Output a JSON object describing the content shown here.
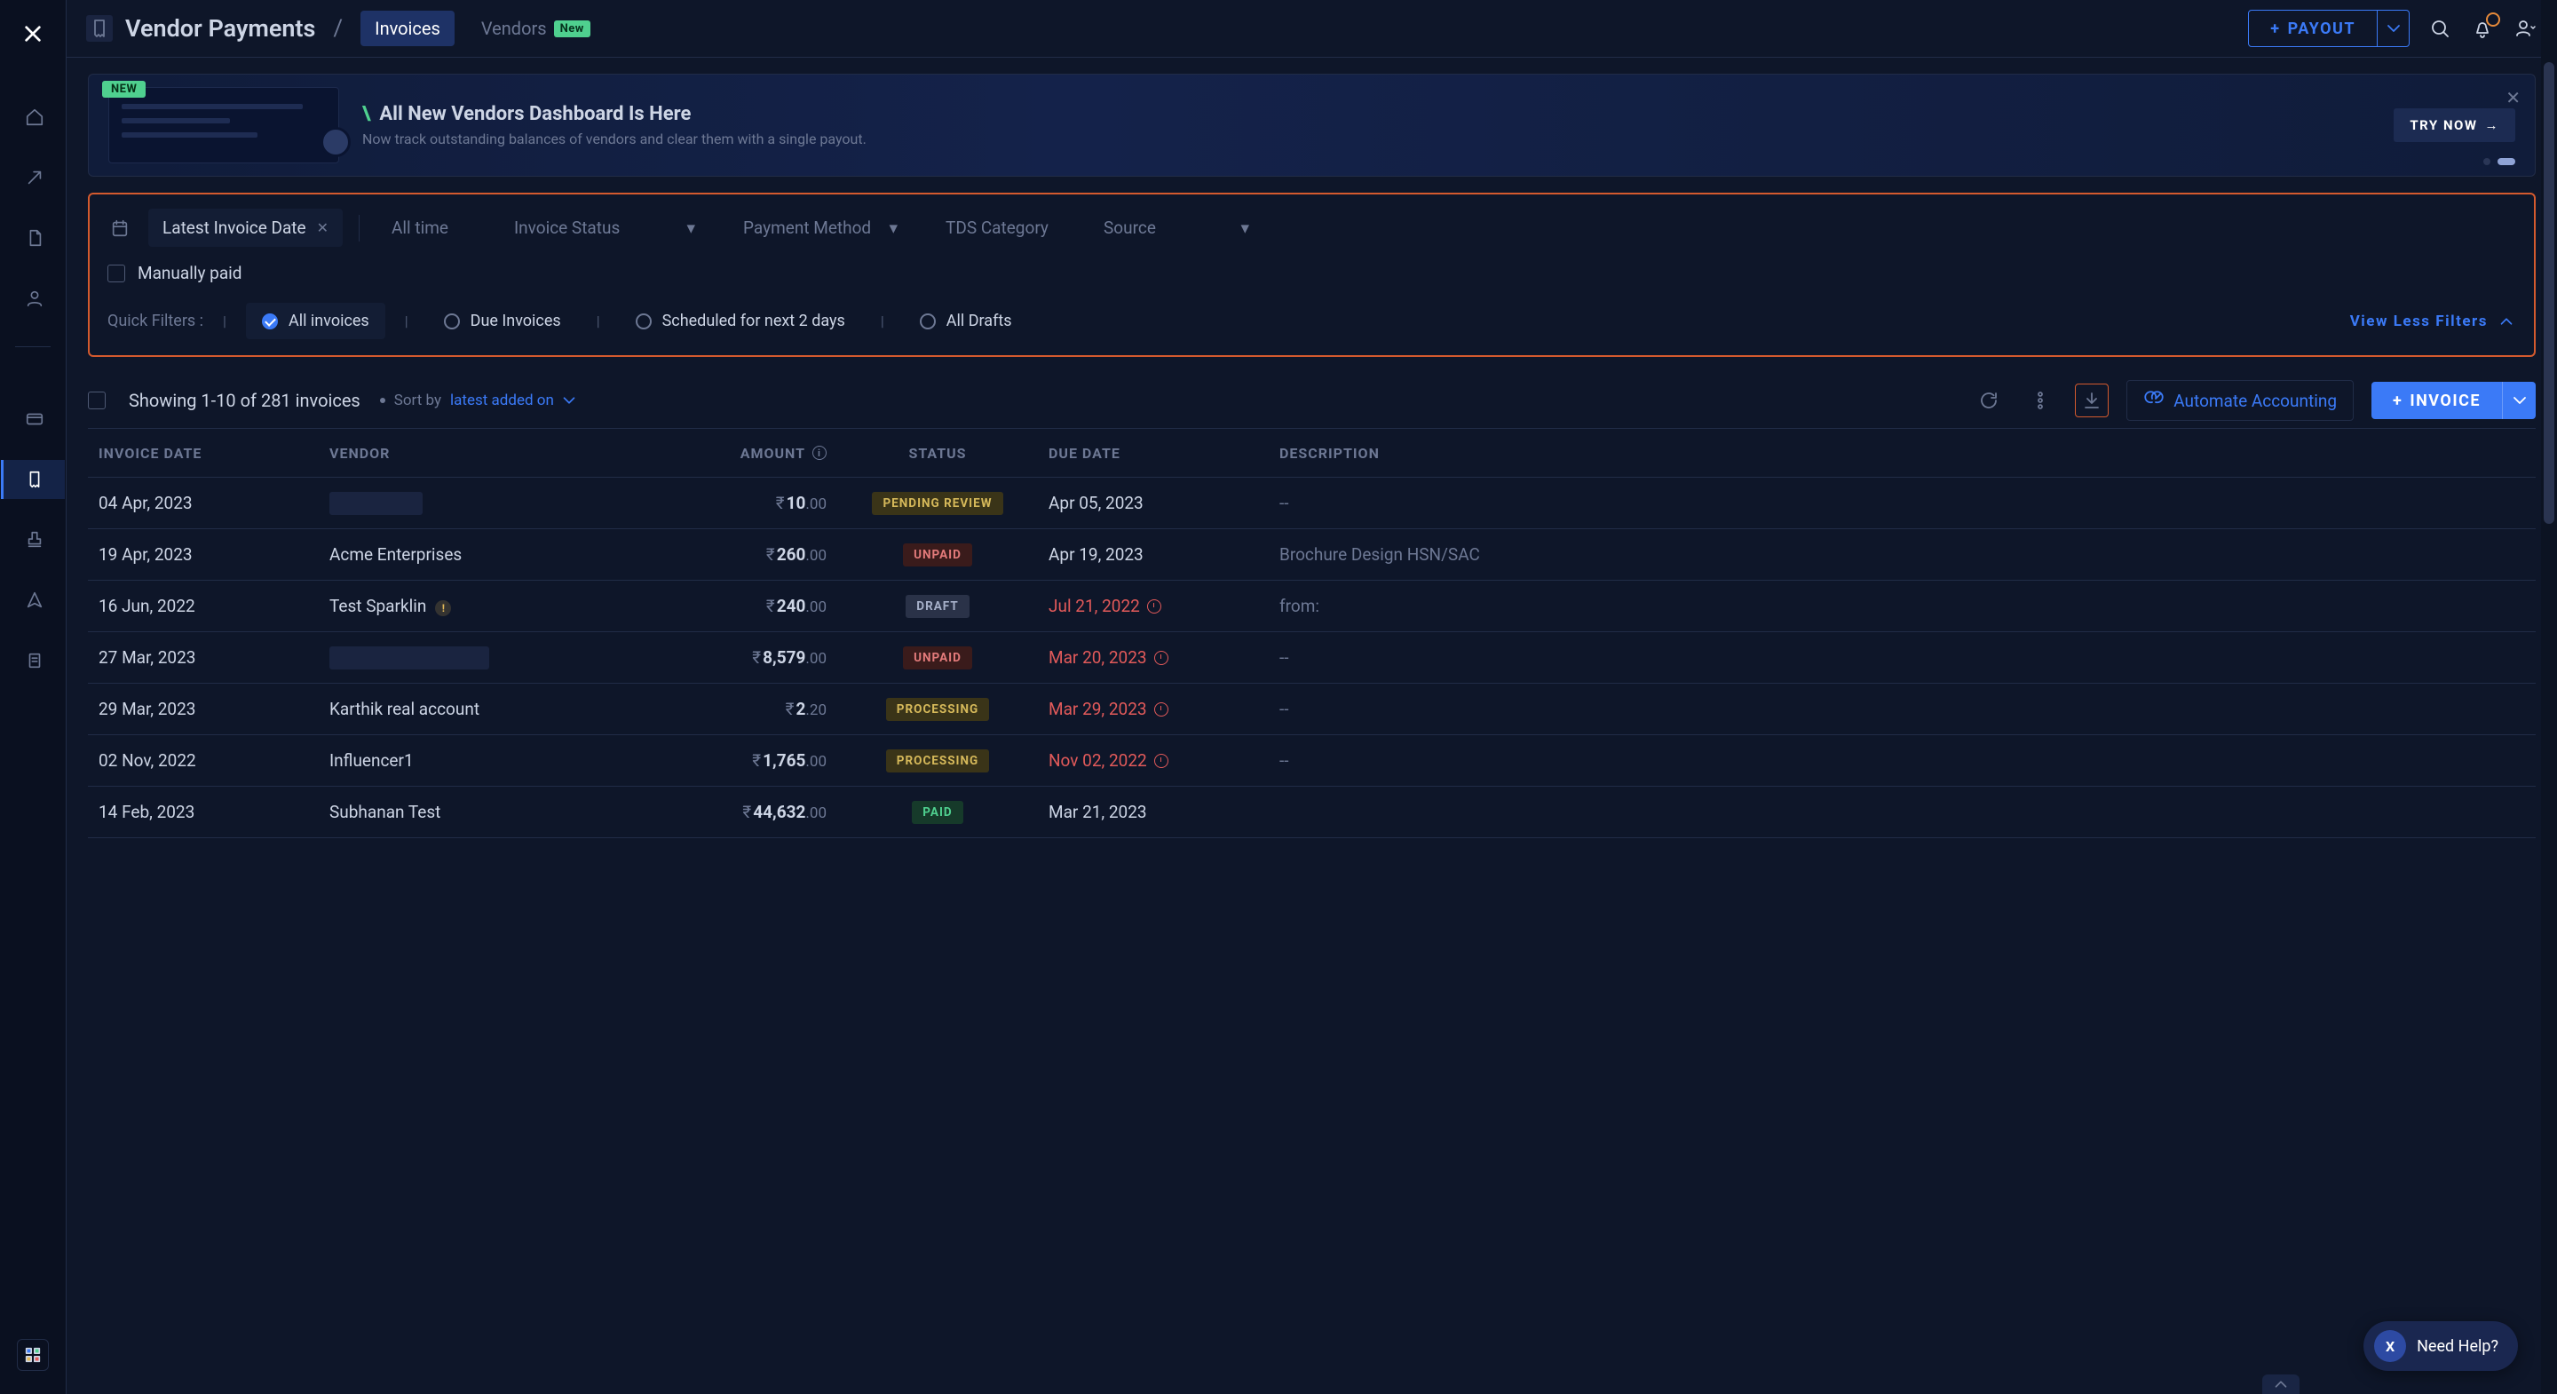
{
  "header": {
    "title": "Vendor Payments",
    "tabs": {
      "invoices": "Invoices",
      "vendors": "Vendors",
      "new_badge": "New"
    },
    "payout_label": "PAYOUT"
  },
  "banner": {
    "chip": "NEW",
    "heading": "All New Vendors Dashboard Is Here",
    "sub": "Now track outstanding balances of vendors and clear them with a single payout.",
    "cta": "TRY NOW"
  },
  "filters": {
    "date_chip": "Latest Invoice Date",
    "range": "All time",
    "invoice_status": "Invoice Status",
    "payment_method": "Payment Method",
    "tds": "TDS Category",
    "source": "Source",
    "manually_paid": "Manually paid",
    "quick_label": "Quick Filters :",
    "q_all": "All invoices",
    "q_due": "Due Invoices",
    "q_sched": "Scheduled for next 2 days",
    "q_drafts": "All Drafts",
    "view_less": "View Less Filters"
  },
  "toolbar": {
    "showing": "Showing 1-10 of 281 invoices",
    "sort_label": "Sort by",
    "sort_value": "latest added on",
    "automate": "Automate Accounting",
    "invoice": "INVOICE"
  },
  "columns": {
    "date": "INVOICE DATE",
    "vendor": "VENDOR",
    "amount": "AMOUNT",
    "status": "STATUS",
    "due": "DUE DATE",
    "desc": "DESCRIPTION"
  },
  "status_labels": {
    "pending": "PENDING REVIEW",
    "unpaid": "UNPAID",
    "draft": "DRAFT",
    "processing": "PROCESSING",
    "paid": "PAID"
  },
  "rows": [
    {
      "date": "04 Apr, 2023",
      "vendor": "",
      "vendor_redacted": true,
      "amount_main": "10",
      "amount_cents": ".00",
      "status": "pending",
      "due": "Apr 05, 2023",
      "overdue": false,
      "desc": "--"
    },
    {
      "date": "19 Apr, 2023",
      "vendor": "Acme Enterprises",
      "amount_main": "260",
      "amount_cents": ".00",
      "status": "unpaid",
      "due": "Apr 19, 2023",
      "overdue": false,
      "desc": "Brochure Design HSN/SAC"
    },
    {
      "date": "16 Jun, 2022",
      "vendor": "Test Sparklin",
      "vendor_warn": true,
      "amount_main": "240",
      "amount_cents": ".00",
      "status": "draft",
      "due": "Jul 21, 2022",
      "overdue": true,
      "desc": "from:"
    },
    {
      "date": "27 Mar, 2023",
      "vendor": "",
      "vendor_redacted": true,
      "vendor_wide": true,
      "amount_main": "8,579",
      "amount_cents": ".00",
      "status": "unpaid",
      "due": "Mar 20, 2023",
      "overdue": true,
      "desc": "--"
    },
    {
      "date": "29 Mar, 2023",
      "vendor": "Karthik real account",
      "amount_main": "2",
      "amount_cents": ".20",
      "status": "processing",
      "due": "Mar 29, 2023",
      "overdue": true,
      "desc": "--"
    },
    {
      "date": "02 Nov, 2022",
      "vendor": "Influencer1",
      "amount_main": "1,765",
      "amount_cents": ".00",
      "status": "processing",
      "due": "Nov 02, 2022",
      "overdue": true,
      "desc": "--"
    },
    {
      "date": "14 Feb, 2023",
      "vendor": "Subhanan Test",
      "amount_main": "44,632",
      "amount_cents": ".00",
      "status": "paid",
      "due": "Mar 21, 2023",
      "overdue": false,
      "desc": ""
    }
  ],
  "help": {
    "label": "Need Help?",
    "initial": "X"
  }
}
